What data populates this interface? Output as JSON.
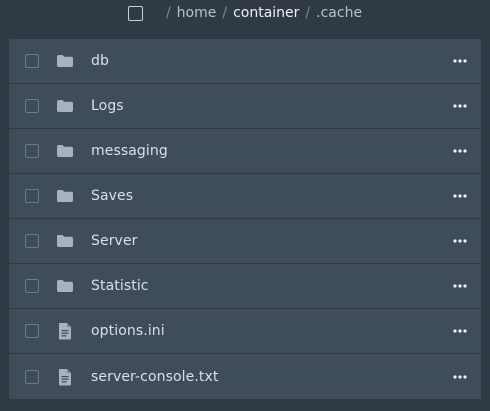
{
  "breadcrumb": {
    "segments": [
      "home",
      "container",
      ".cache"
    ]
  },
  "items": [
    {
      "name": "db",
      "type": "folder"
    },
    {
      "name": "Logs",
      "type": "folder"
    },
    {
      "name": "messaging",
      "type": "folder"
    },
    {
      "name": "Saves",
      "type": "folder"
    },
    {
      "name": "Server",
      "type": "folder"
    },
    {
      "name": "Statistic",
      "type": "folder"
    },
    {
      "name": "options.ini",
      "type": "file"
    },
    {
      "name": "server-console.txt",
      "type": "file"
    }
  ]
}
